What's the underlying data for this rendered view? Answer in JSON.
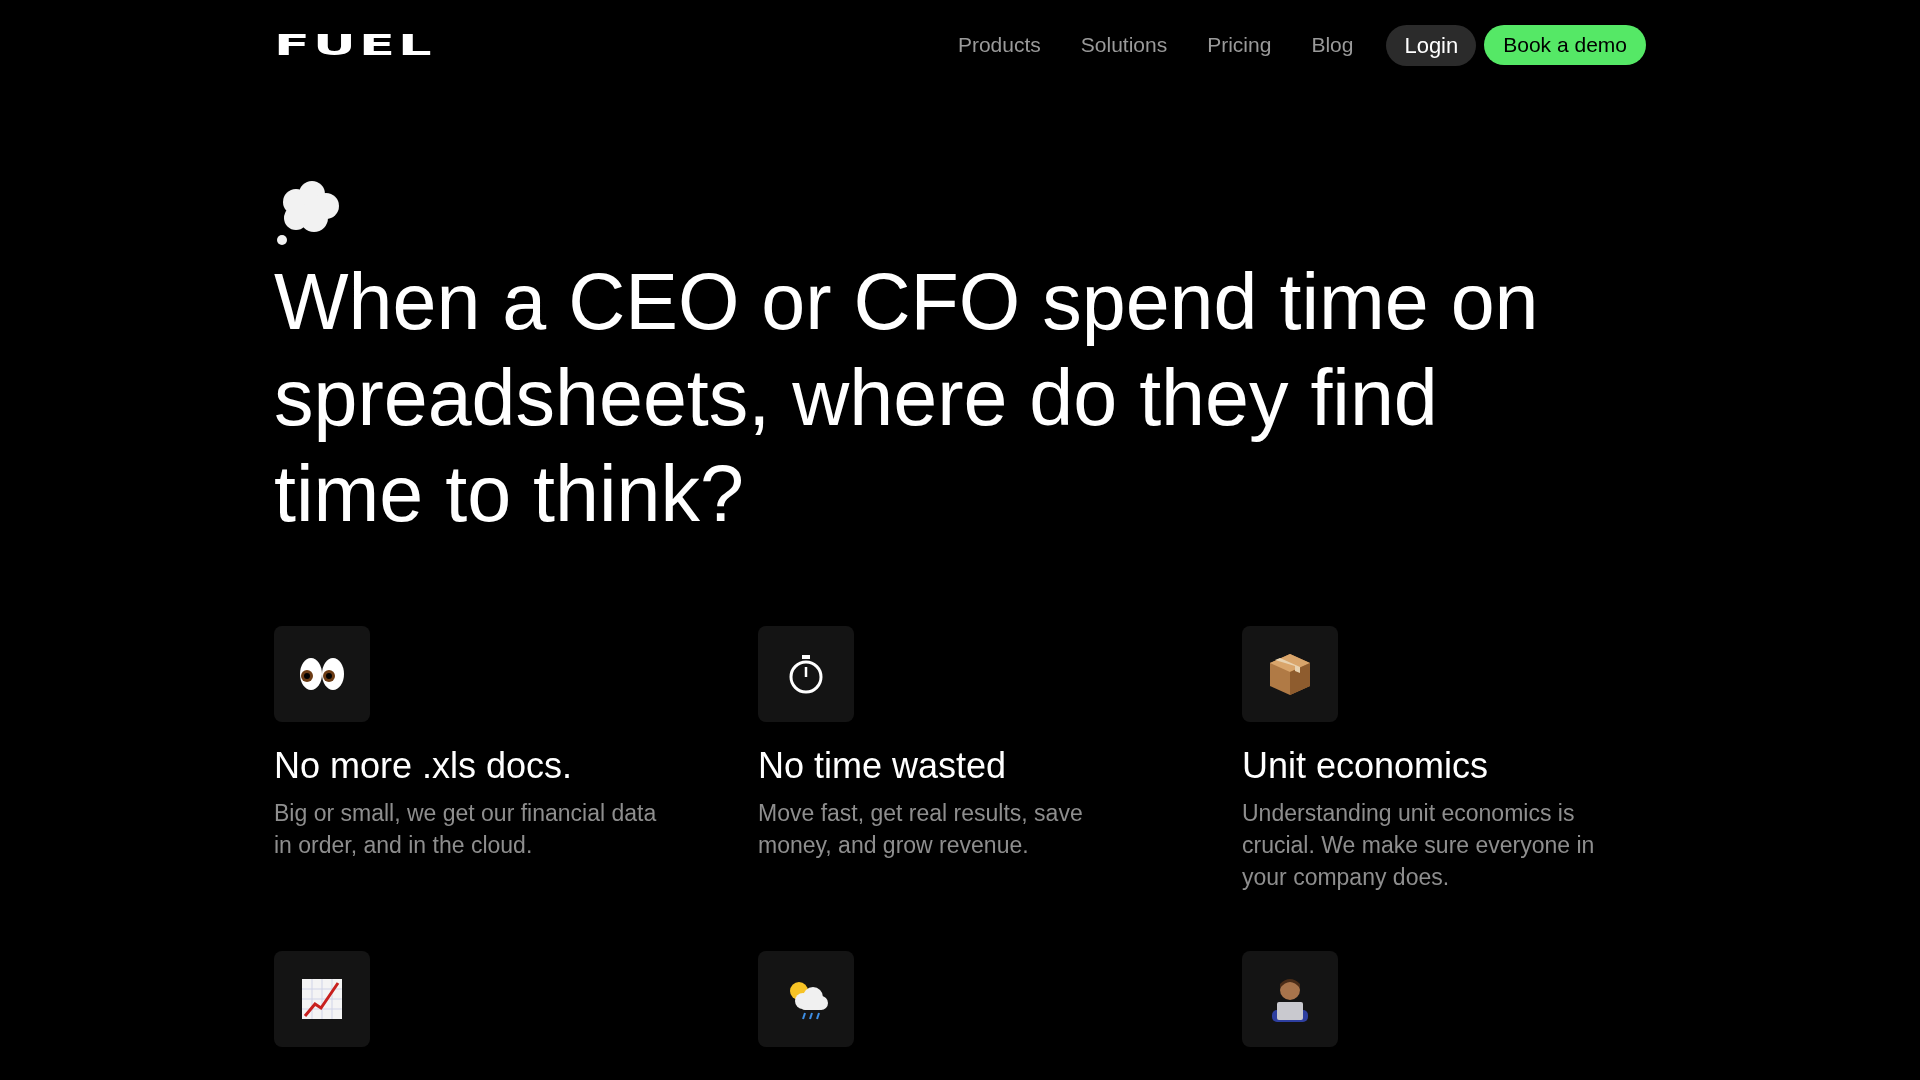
{
  "navbar": {
    "logo": "FUEL",
    "links": [
      {
        "label": "Products"
      },
      {
        "label": "Solutions"
      },
      {
        "label": "Pricing"
      },
      {
        "label": "Blog"
      }
    ],
    "login": "Login",
    "cta": "Book a demo"
  },
  "hero": {
    "headline": "When a CEO or CFO spend time on spreadsheets, where do they find time to think?"
  },
  "features": [
    {
      "kind": "eyes",
      "title": "No more .xls docs.",
      "text": "Big or small, we get our financial data in order, and in the cloud."
    },
    {
      "kind": "stopwatch",
      "title": "No time wasted",
      "text": "Move fast, get real results, save money, and grow revenue."
    },
    {
      "kind": "package",
      "title": "Unit economics",
      "text": "Understanding unit economics is crucial. We make sure everyone in your company does."
    },
    {
      "kind": "chart"
    },
    {
      "kind": "weather"
    },
    {
      "kind": "laptop-person"
    }
  ]
}
